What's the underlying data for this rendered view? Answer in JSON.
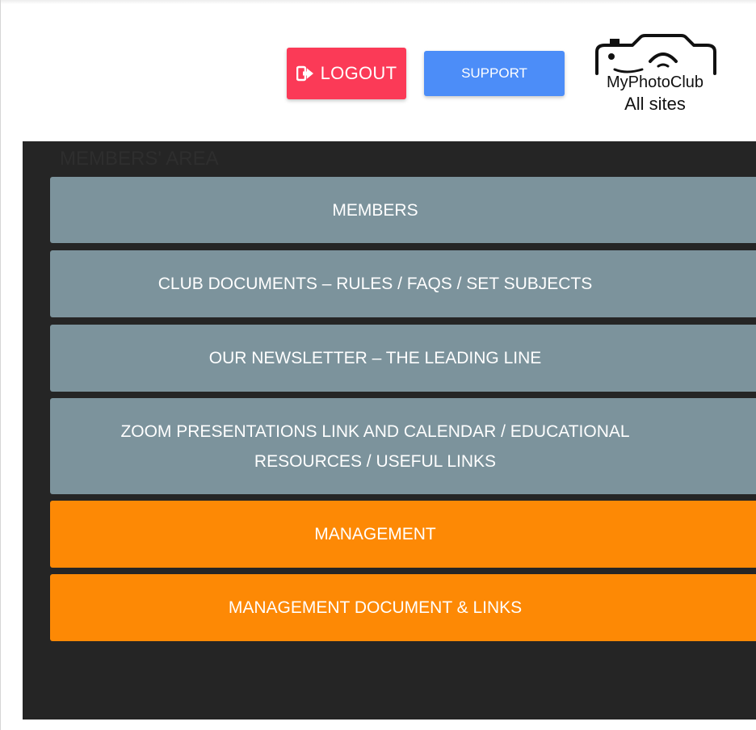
{
  "header": {
    "logout_label": "LOGOUT",
    "support_label": "SUPPORT",
    "logo": {
      "name": "MyPhotoClub",
      "subtitle": "All sites",
      "icon": "camera-icon"
    }
  },
  "panel": {
    "faint_heading": "MEMBERS' AREA",
    "items": [
      {
        "label": "MEMBERS",
        "color": "#7c939c"
      },
      {
        "label": "CLUB DOCUMENTS – RULES / FAQS / SET SUBJECTS",
        "color": "#7c939c"
      },
      {
        "label": "OUR NEWSLETTER – THE LEADING LINE",
        "color": "#7c939c"
      },
      {
        "label": "ZOOM PRESENTATIONS LINK AND CALENDAR / EDUCATIONAL RESOURCES / USEFUL LINKS",
        "color": "#7c939c"
      },
      {
        "label": "MANAGEMENT",
        "color": "#fd8905"
      },
      {
        "label": "MANAGEMENT DOCUMENT & LINKS",
        "color": "#fd8905"
      }
    ]
  },
  "colors": {
    "logout": "#fb3a57",
    "support": "#4c8df8",
    "panel_bg": "#252525",
    "member_button": "#7c939c",
    "management_button": "#fd8905"
  },
  "icons": {
    "logout": "sign-out-icon"
  }
}
